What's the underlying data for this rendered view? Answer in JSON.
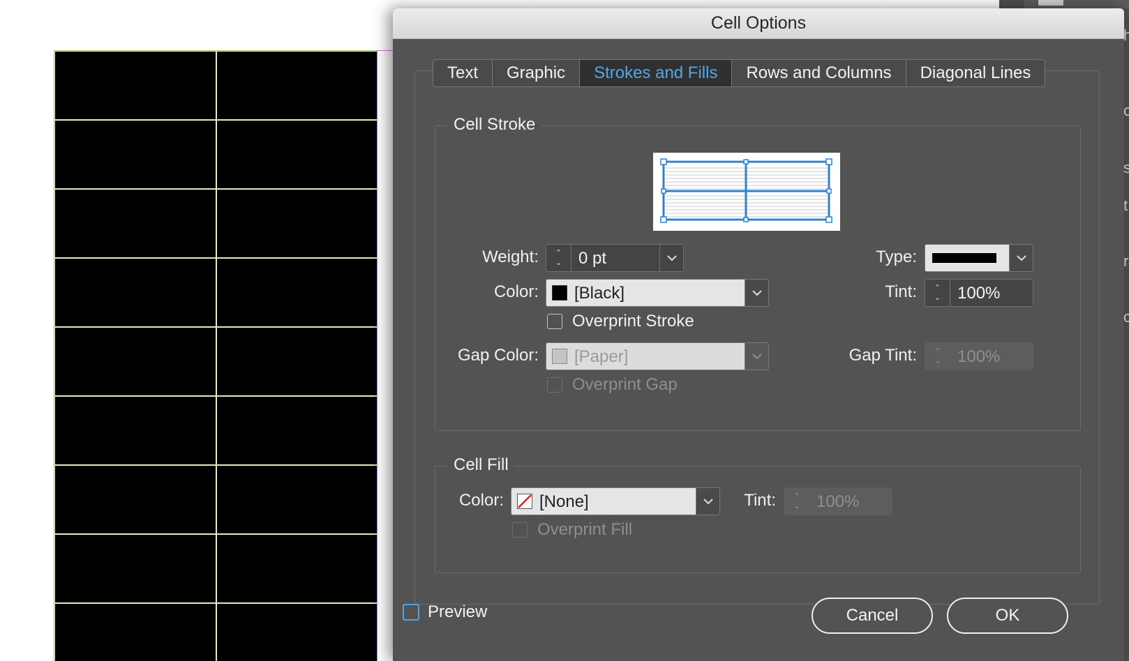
{
  "dialog": {
    "title": "Cell Options",
    "tabs": [
      {
        "label": "Text"
      },
      {
        "label": "Graphic"
      },
      {
        "label": "Strokes and Fills",
        "active": true
      },
      {
        "label": "Rows and Columns"
      },
      {
        "label": "Diagonal Lines"
      }
    ]
  },
  "cell_stroke": {
    "group_title": "Cell Stroke",
    "weight": {
      "label": "Weight:",
      "value": "0 pt"
    },
    "type": {
      "label": "Type:"
    },
    "color": {
      "label": "Color:",
      "value": "[Black]",
      "swatch_color": "#000000"
    },
    "tint": {
      "label": "Tint:",
      "value": "100%"
    },
    "overprint_stroke": {
      "label": "Overprint Stroke",
      "checked": false
    },
    "gap_color": {
      "label": "Gap Color:",
      "value": "[Paper]",
      "disabled": true
    },
    "gap_tint": {
      "label": "Gap Tint:",
      "value": "100%",
      "disabled": true
    },
    "overprint_gap": {
      "label": "Overprint Gap",
      "checked": false,
      "disabled": true
    }
  },
  "cell_fill": {
    "group_title": "Cell Fill",
    "color": {
      "label": "Color:",
      "value": "[None]"
    },
    "tint": {
      "label": "Tint:",
      "value": "100%",
      "disabled": true
    },
    "overprint_fill": {
      "label": "Overprint Fill",
      "checked": false,
      "disabled": true
    }
  },
  "footer": {
    "preview": {
      "label": "Preview",
      "checked": false
    },
    "cancel_label": "Cancel",
    "ok_label": "OK"
  },
  "side_panel": {
    "letters": [
      "h",
      "o",
      "s",
      "t",
      "r",
      "c"
    ]
  },
  "colors": {
    "accent": "#4ea8ec",
    "dialog_bg": "#535353",
    "table_cell": "#000000"
  }
}
